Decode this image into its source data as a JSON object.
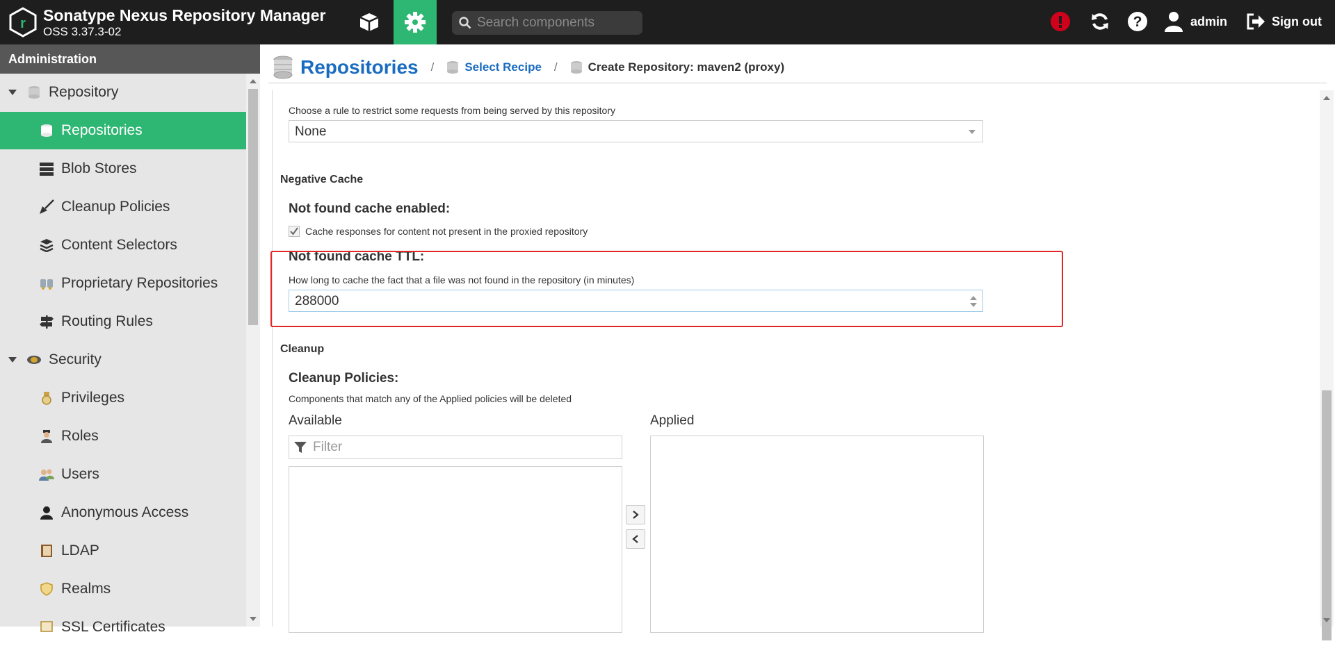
{
  "app": {
    "title": "Sonatype Nexus Repository Manager",
    "version": "OSS 3.37.3-02",
    "logo_letter": "r"
  },
  "topbar": {
    "search_placeholder": "Search components",
    "user_label": "admin",
    "signout_label": "Sign out",
    "colors": {
      "accent": "#2eb673",
      "alert": "#d0021b"
    }
  },
  "sidebar": {
    "header": "Administration",
    "items": [
      {
        "label": "Repository",
        "kind": "group",
        "icon": "database-icon"
      },
      {
        "label": "Repositories",
        "kind": "child",
        "icon": "database-icon",
        "active": true
      },
      {
        "label": "Blob Stores",
        "kind": "child",
        "icon": "server-icon"
      },
      {
        "label": "Cleanup Policies",
        "kind": "child",
        "icon": "broom-icon"
      },
      {
        "label": "Content Selectors",
        "kind": "child",
        "icon": "layers-icon"
      },
      {
        "label": "Proprietary Repositories",
        "kind": "child",
        "icon": "proprietary-icon"
      },
      {
        "label": "Routing Rules",
        "kind": "child",
        "icon": "signpost-icon"
      },
      {
        "label": "Security",
        "kind": "group",
        "icon": "security-icon"
      },
      {
        "label": "Privileges",
        "kind": "child",
        "icon": "medal-icon"
      },
      {
        "label": "Roles",
        "kind": "child",
        "icon": "role-icon"
      },
      {
        "label": "Users",
        "kind": "child",
        "icon": "users-icon"
      },
      {
        "label": "Anonymous Access",
        "kind": "child",
        "icon": "user-icon"
      },
      {
        "label": "LDAP",
        "kind": "child",
        "icon": "book-icon"
      },
      {
        "label": "Realms",
        "kind": "child",
        "icon": "shield-icon"
      },
      {
        "label": "SSL Certificates",
        "kind": "child",
        "icon": "certificate-icon"
      }
    ]
  },
  "breadcrumb": {
    "title": "Repositories",
    "sep": "/",
    "step1": "Select Recipe",
    "current": "Create Repository: maven2 (proxy)"
  },
  "form": {
    "routing_help": "Choose a rule to restrict some requests from being served by this repository",
    "routing_value": "None",
    "negative_cache_section": "Negative Cache",
    "nfc_enabled_label": "Not found cache enabled:",
    "nfc_enabled_checkbox_label": "Cache responses for content not present in the proxied repository",
    "nfc_enabled_checked": true,
    "nfc_ttl_label": "Not found cache TTL:",
    "nfc_ttl_help": "How long to cache the fact that a file was not found in the repository (in minutes)",
    "nfc_ttl_value": "288000",
    "cleanup_section": "Cleanup",
    "cleanup_label": "Cleanup Policies:",
    "cleanup_help": "Components that match any of the Applied policies will be deleted",
    "available_label": "Available",
    "applied_label": "Applied",
    "filter_placeholder": "Filter"
  }
}
